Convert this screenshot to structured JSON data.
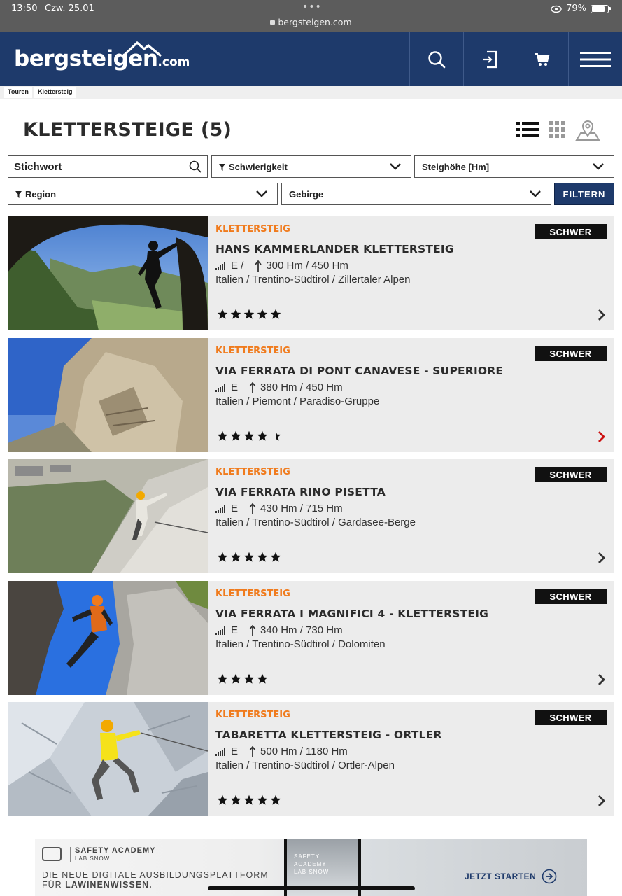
{
  "status_bar": {
    "time": "13:50",
    "date": "Czw. 25.01",
    "url": "bergsteigen.com",
    "battery": "79%"
  },
  "header": {
    "logo_main": "bergsteigen",
    "logo_tld": ".com",
    "icons": [
      "search-icon",
      "login-icon",
      "cart-icon",
      "menu-icon"
    ]
  },
  "breadcrumb": [
    "Touren",
    "Klettersteig"
  ],
  "page": {
    "title": "KLETTERSTEIGE (5)"
  },
  "filters": {
    "search_placeholder": "Stichwort",
    "difficulty": "Schwierigkeit",
    "height": "Steighöhe [Hm]",
    "region": "Region",
    "range": "Gebirge",
    "submit": "FILTERN"
  },
  "tours": [
    {
      "category": "KLETTERSTEIG",
      "badge": "SCHWER",
      "title": "HANS KAMMERLANDER KLETTERSTEIG",
      "grade": "E /",
      "ascent": "300 Hm / 450 Hm",
      "location": "Italien / Trentino-Südtirol / Zillertaler Alpen",
      "rating": 5
    },
    {
      "category": "KLETTERSTEIG",
      "badge": "SCHWER",
      "title": "VIA FERRATA DI PONT CANAVESE - SUPERIORE",
      "grade": "E",
      "ascent": "380 Hm / 450 Hm",
      "location": "Italien / Piemont / Paradiso-Gruppe",
      "rating": 4.5
    },
    {
      "category": "KLETTERSTEIG",
      "badge": "SCHWER",
      "title": "VIA FERRATA RINO PISETTA",
      "grade": "E",
      "ascent": "430 Hm / 715 Hm",
      "location": "Italien / Trentino-Südtirol / Gardasee-Berge",
      "rating": 5
    },
    {
      "category": "KLETTERSTEIG",
      "badge": "SCHWER",
      "title": "VIA FERRATA I MAGNIFICI 4 - KLETTERSTEIG",
      "grade": "E",
      "ascent": "340 Hm / 730 Hm",
      "location": "Italien / Trentino-Südtirol / Dolomiten",
      "rating": 4
    },
    {
      "category": "KLETTERSTEIG",
      "badge": "SCHWER",
      "title": "TABARETTA KLETTERSTEIG - ORTLER",
      "grade": "E",
      "ascent": "500 Hm / 1180 Hm",
      "location": "Italien / Trentino-Südtirol / Ortler-Alpen",
      "rating": 5
    }
  ],
  "ad": {
    "brand": "SAFETY ACADEMY",
    "brand_sub": "LAB SNOW",
    "text_line1": "DIE NEUE DIGITALE AUSBILDUNGSPLATTFORM",
    "text_line2_prefix": "FÜR ",
    "text_line2_bold": "LAWINENWISSEN.",
    "phone_text_1": "SAFETY",
    "phone_text_2": "ACADEMY",
    "phone_text_3": "LAB SNOW",
    "cta": "JETZT STARTEN"
  },
  "colors": {
    "header_bg": "#1e3a6b",
    "category": "#f07b1d",
    "active_arrow": "#cc1111"
  }
}
